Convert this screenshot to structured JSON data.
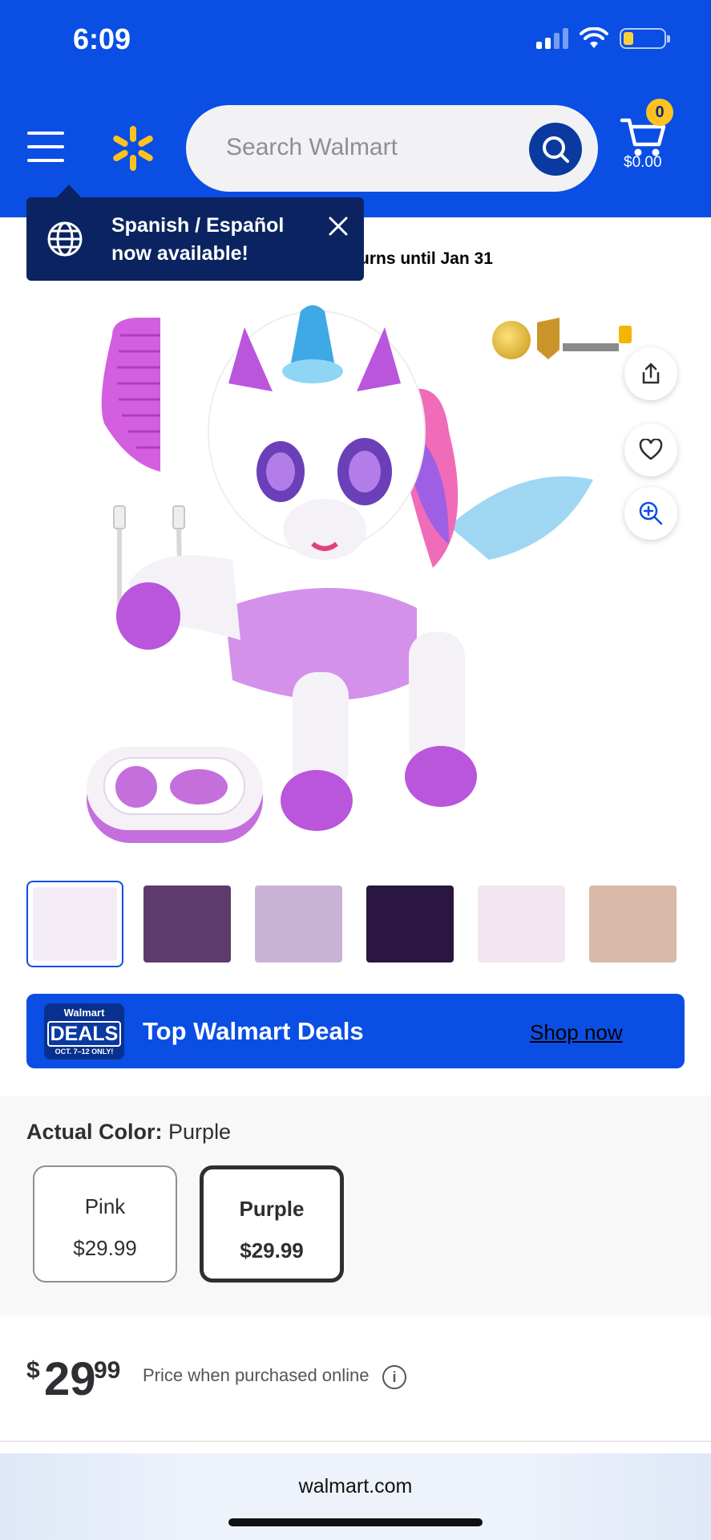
{
  "status_bar": {
    "time": "6:09"
  },
  "header": {
    "search_placeholder": "Search Walmart",
    "cart_count": "0",
    "cart_total": "$0.00"
  },
  "tooltip": {
    "message_line1": "Spanish / Español",
    "message_line2": "now available!"
  },
  "returns_text": "urns until Jan 31",
  "product": {
    "thumbnails": [
      {
        "selected": true,
        "color": "#f3ecf7"
      },
      {
        "selected": false,
        "color": "#5e3a6d"
      },
      {
        "selected": false,
        "color": "#c9b3d6"
      },
      {
        "selected": false,
        "color": "#2a1640"
      },
      {
        "selected": false,
        "color": "#f3e6f1"
      },
      {
        "selected": false,
        "color": "#d9b9a8"
      }
    ]
  },
  "deals_banner": {
    "badge_top": "Walmart",
    "badge_main": "DEALS",
    "badge_dates": "OCT. 7–12 ONLY!",
    "title": "Top Walmart Deals",
    "link": "Shop now"
  },
  "color_selector": {
    "label": "Actual Color:",
    "selected_value": "Purple",
    "options": [
      {
        "name": "Pink",
        "price": "$29.99"
      },
      {
        "name": "Purple",
        "price": "$29.99"
      }
    ]
  },
  "price": {
    "currency": "$",
    "whole": "29",
    "cents": "99",
    "note": "Price when purchased online",
    "info_glyph": "i"
  },
  "browser": {
    "url": "walmart.com"
  },
  "colors": {
    "brand_blue": "#0a4ee4",
    "spark_yellow": "#ffc220",
    "tooltip_navy": "#0b2461"
  }
}
